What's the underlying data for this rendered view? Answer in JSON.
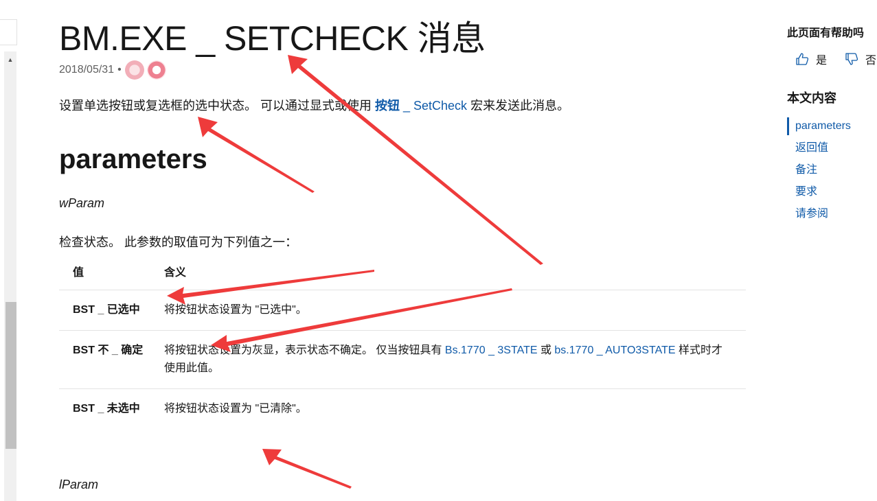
{
  "title": "BM.EXE _ SETCHECK 消息",
  "meta": {
    "date": "2018/05/31",
    "separator": "•"
  },
  "intro": {
    "text_before": "设置单选按钮或复选框的选中状态。 可以通过显式或使用 ",
    "link_bold": "按钮",
    "link_rest": " _ SetCheck",
    "text_after": " 宏来发送此消息。"
  },
  "section_heading": "parameters",
  "wparam": {
    "name": "wParam",
    "description": "检查状态。 此参数的取值可为下列值之一："
  },
  "table": {
    "headers": [
      "值",
      "含义"
    ],
    "rows": [
      {
        "value": "BST _ 已选中",
        "meaning": "将按钮状态设置为 \"已选中\"。"
      },
      {
        "value": "BST 不 _ 确定",
        "meaning_before": "将按钮状态设置为灰显，表示状态不确定。 仅当按钮具有 ",
        "link1": "Bs.1770 _ 3STATE",
        "meaning_mid": " 或 ",
        "link2": "bs.1770 _ AUTO3STATE",
        "meaning_after": " 样式时才使用此值。"
      },
      {
        "value": "BST _ 未选中",
        "meaning": "将按钮状态设置为 \"已清除\"。"
      }
    ]
  },
  "lparam": {
    "name": "lParam"
  },
  "rail": {
    "help_question": "此页面有帮助吗",
    "yes_label": "是",
    "no_label": "否",
    "toc_title": "本文内容",
    "toc_items": [
      "parameters",
      "返回值",
      "备注",
      "要求",
      "请参阅"
    ]
  },
  "colors": {
    "link": "#0f5aa8",
    "annotation_arrow": "#ee3b3b",
    "scroll_thumb": "#c1c1c1"
  },
  "icons": {
    "thumbs_up": "thumbs-up-icon",
    "thumbs_down": "thumbs-down-icon",
    "scroll_up": "scroll-up-arrow-icon"
  }
}
